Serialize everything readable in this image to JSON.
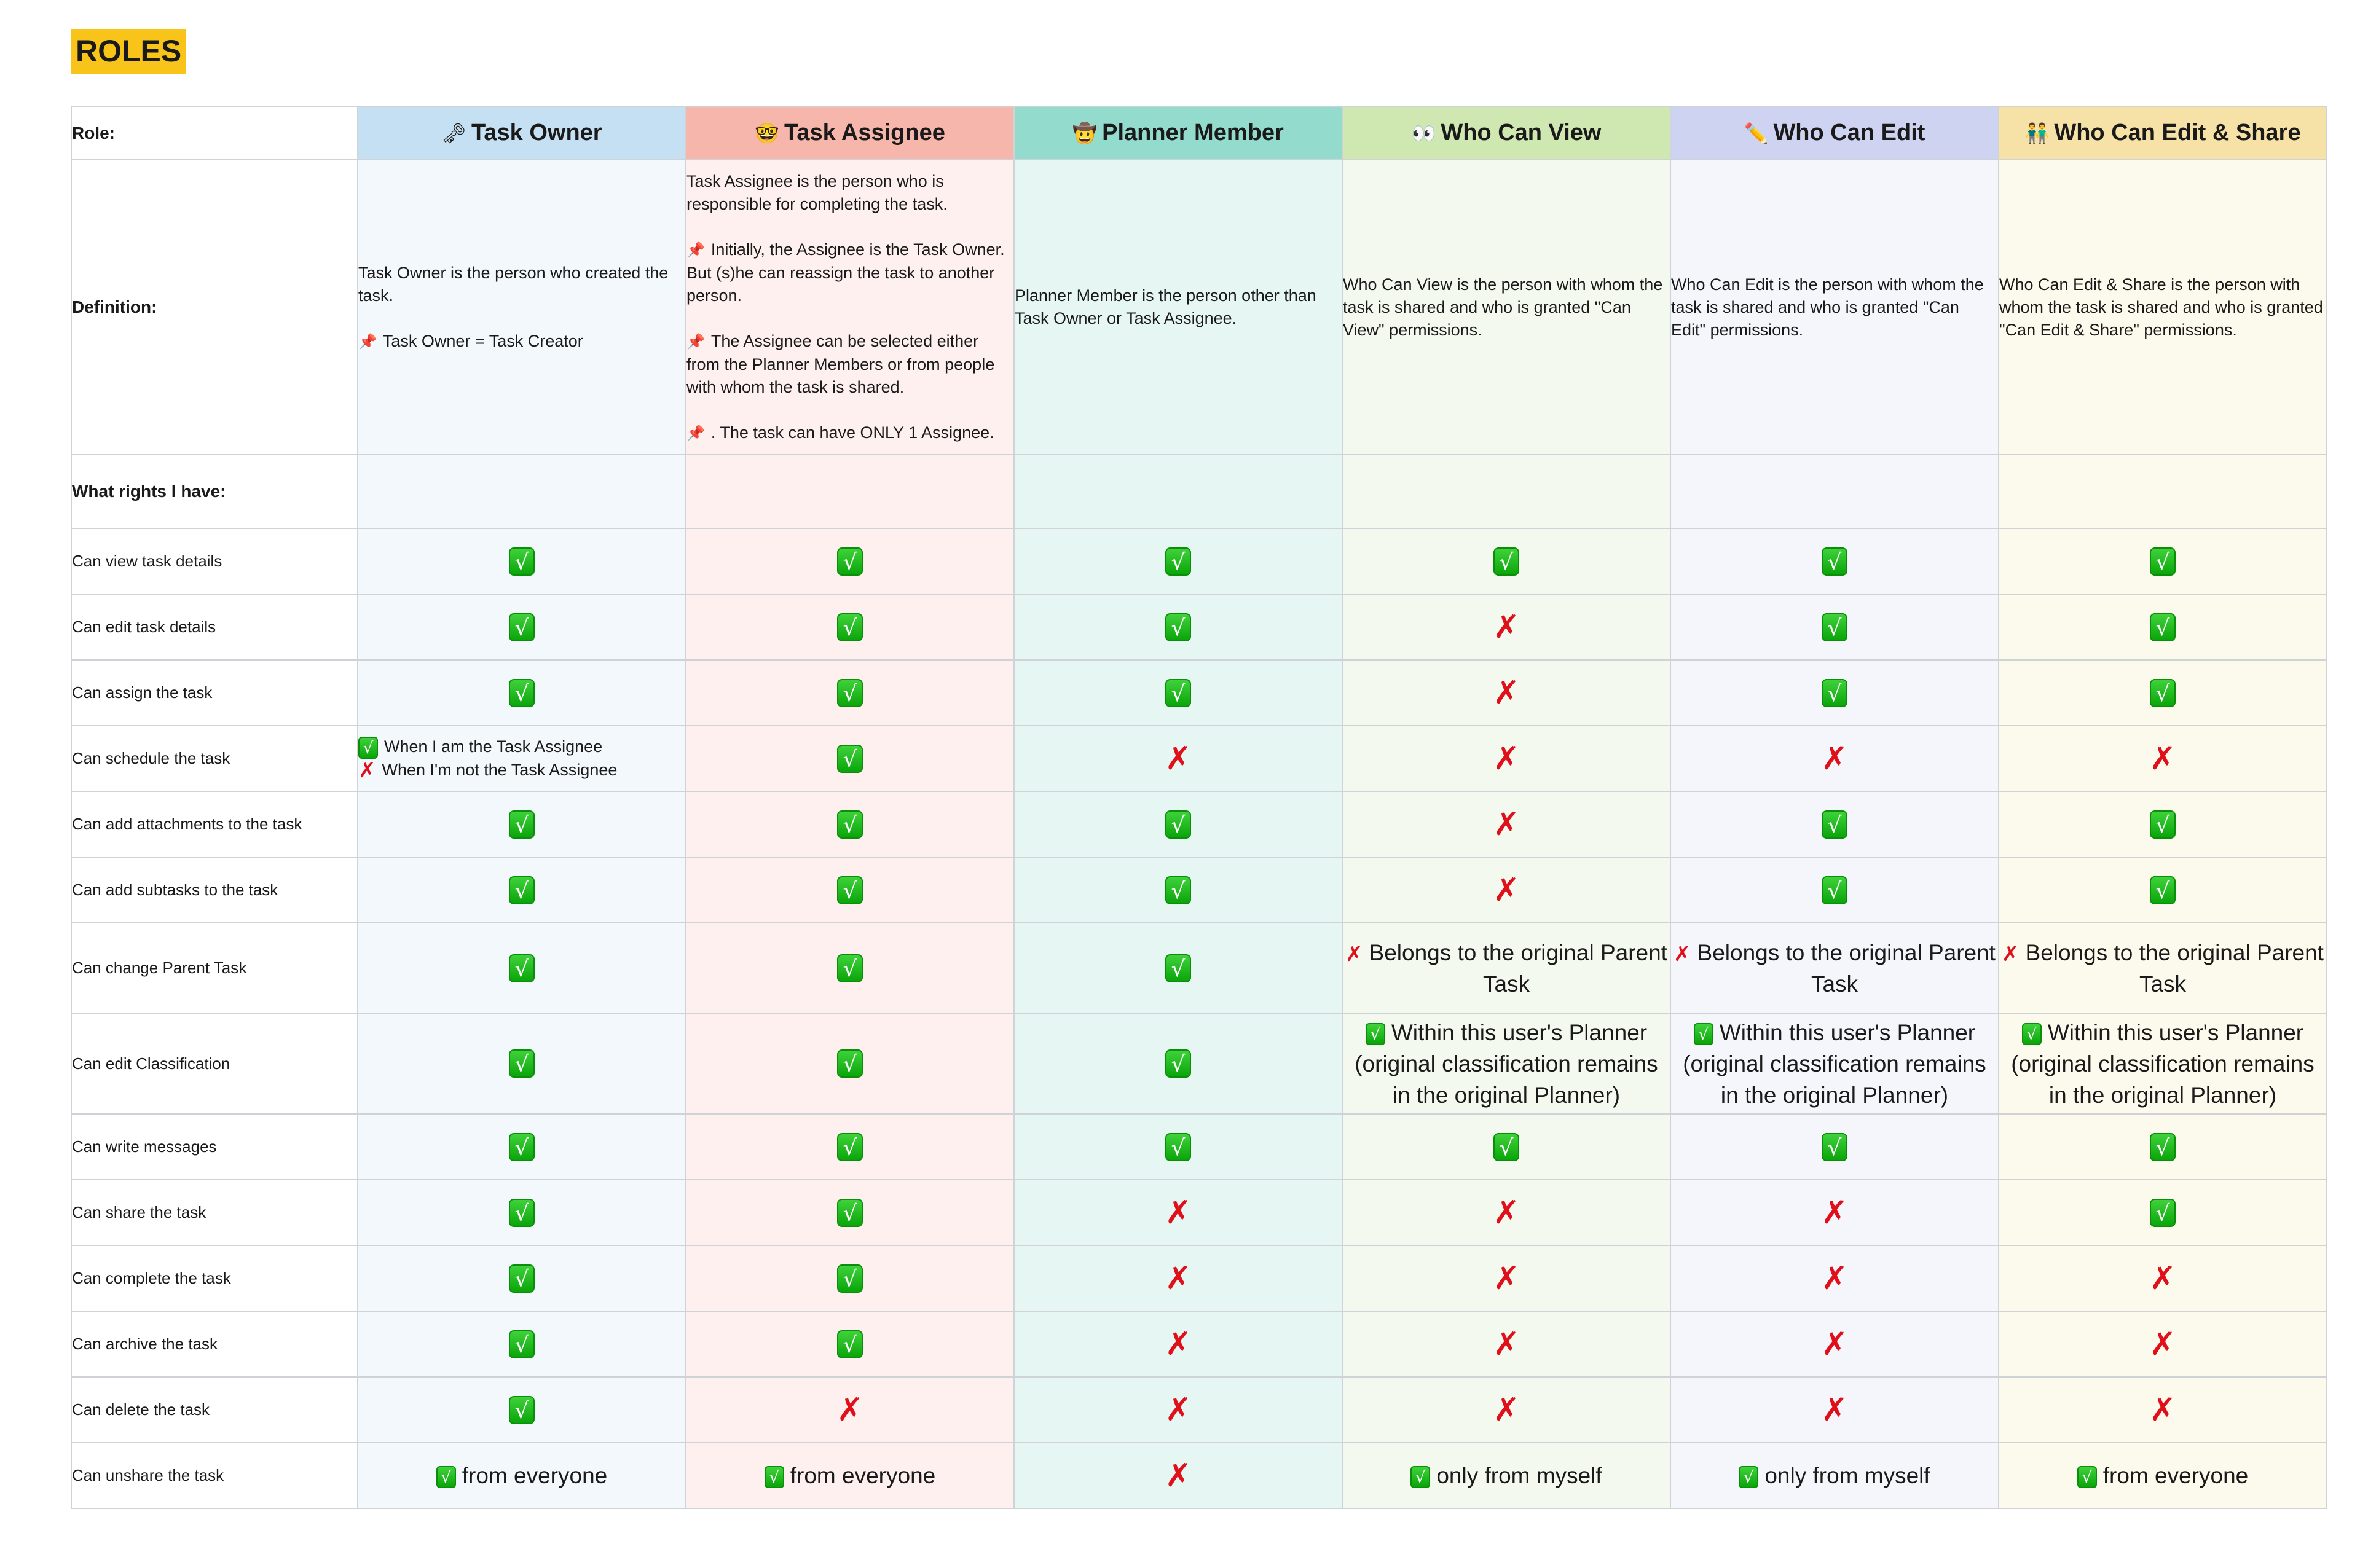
{
  "title": "ROLES",
  "header": {
    "role_label": "Role:",
    "definition_label": "Definition:",
    "rights_label": "What rights I have:"
  },
  "colors": {
    "title_bg": "#f8c41a",
    "check_green": "#0aa50a",
    "cross_red": "#e0101a"
  },
  "roles": [
    {
      "name": "Task Owner",
      "icon": "old-key-icon",
      "emoji": "🗝",
      "header_bg": "#c5e0f2",
      "body_bg": "#f2f8fc",
      "definition": "Task Owner is the person who created the task.",
      "notes": [
        "Task Owner = Task Creator"
      ]
    },
    {
      "name": "Task Assignee",
      "icon": "nerd-face-icon",
      "emoji": "🤓",
      "header_bg": "#f7b6ab",
      "body_bg": "#fdf0ee",
      "definition": "Task Assignee is the person who is responsible for completing the task.",
      "notes": [
        "Initially, the Assignee is the Task Owner. But (s)he can reassign the task to another person.",
        "The Assignee can be selected either from the Planner Members or from people with whom the task is shared.",
        ". The task can have ONLY 1 Assignee."
      ]
    },
    {
      "name": "Planner Member",
      "icon": "cowboy-face-icon",
      "emoji": "🤠",
      "header_bg": "#93dccd",
      "body_bg": "#e6f6f2",
      "definition": "Planner Member is the person other than Task Owner or Task Assignee.",
      "notes": []
    },
    {
      "name": "Who Can View",
      "icon": "eyes-icon",
      "emoji": "👀",
      "header_bg": "#cfe8b1",
      "body_bg": "#f3f9ee",
      "definition": "Who Can View is the person with whom the task is shared and who is granted \"Can View\" permissions.",
      "notes": []
    },
    {
      "name": "Who Can Edit",
      "icon": "pencil-icon",
      "emoji": "✏️",
      "header_bg": "#cfd3f2",
      "body_bg": "#f5f6fc",
      "definition": "Who Can Edit is the person with whom the task is shared and who is granted \"Can Edit\" permissions.",
      "notes": []
    },
    {
      "name": "Who Can Edit & Share",
      "icon": "two-people-icon",
      "emoji": "👬",
      "header_bg": "#f6e2a6",
      "body_bg": "#fcfaec",
      "definition": "Who Can Edit & Share is the person with whom the task is shared and who is granted \"Can Edit & Share\" permissions.",
      "notes": []
    }
  ],
  "rights": [
    {
      "label": "Can view task details",
      "values": [
        "yes",
        "yes",
        "yes",
        "yes",
        "yes",
        "yes"
      ]
    },
    {
      "label": "Can edit task details",
      "values": [
        "yes",
        "yes",
        "yes",
        "no",
        "yes",
        "yes"
      ]
    },
    {
      "label": "Can assign the task",
      "values": [
        "yes",
        "yes",
        "yes",
        "no",
        "yes",
        "yes"
      ]
    },
    {
      "label": "Can schedule the task",
      "values": [
        {
          "lines": [
            {
              "mark": "yes",
              "text": "When I am the Task Assignee"
            },
            {
              "mark": "no",
              "text": "When I'm not the Task Assignee"
            }
          ]
        },
        "yes",
        "no",
        "no",
        "no",
        "no"
      ]
    },
    {
      "label": "Can add attachments to the task",
      "values": [
        "yes",
        "yes",
        "yes",
        "no",
        "yes",
        "yes"
      ]
    },
    {
      "label": "Can add subtasks to the task",
      "values": [
        "yes",
        "yes",
        "yes",
        "no",
        "yes",
        "yes"
      ]
    },
    {
      "label": "Can change Parent Task",
      "values": [
        "yes",
        "yes",
        "yes",
        {
          "mark": "no",
          "text": "Belongs to the original Parent Task"
        },
        {
          "mark": "no",
          "text": "Belongs to the original Parent Task"
        },
        {
          "mark": "no",
          "text": "Belongs to the original Parent Task"
        }
      ]
    },
    {
      "label": "Can edit Classification",
      "values": [
        "yes",
        "yes",
        "yes",
        {
          "mark": "yes",
          "text": "Within this user's Planner (original classification remains in the original Planner)"
        },
        {
          "mark": "yes",
          "text": "Within this user's Planner (original classification remains in the original Planner)"
        },
        {
          "mark": "yes",
          "text": "Within this user's Planner (original classification remains in the original Planner)"
        }
      ]
    },
    {
      "label": "Can write messages",
      "values": [
        "yes",
        "yes",
        "yes",
        "yes",
        "yes",
        "yes"
      ]
    },
    {
      "label": "Can share the task",
      "values": [
        "yes",
        "yes",
        "no",
        "no",
        "no",
        "yes"
      ]
    },
    {
      "label": "Can complete the task",
      "values": [
        "yes",
        "yes",
        "no",
        "no",
        "no",
        "no"
      ]
    },
    {
      "label": "Can archive the task",
      "values": [
        "yes",
        "yes",
        "no",
        "no",
        "no",
        "no"
      ]
    },
    {
      "label": "Can delete the task",
      "values": [
        "yes",
        "no",
        "no",
        "no",
        "no",
        "no"
      ]
    },
    {
      "label": "Can unshare the task",
      "values": [
        {
          "mark": "yes",
          "text": "from everyone"
        },
        {
          "mark": "yes",
          "text": "from everyone"
        },
        "no",
        {
          "mark": "yes",
          "text": "only from myself"
        },
        {
          "mark": "yes",
          "text": "only from myself"
        },
        {
          "mark": "yes",
          "text": "from everyone"
        }
      ]
    }
  ],
  "glyphs": {
    "yes": "√",
    "no": "✗",
    "pin": "📌"
  }
}
